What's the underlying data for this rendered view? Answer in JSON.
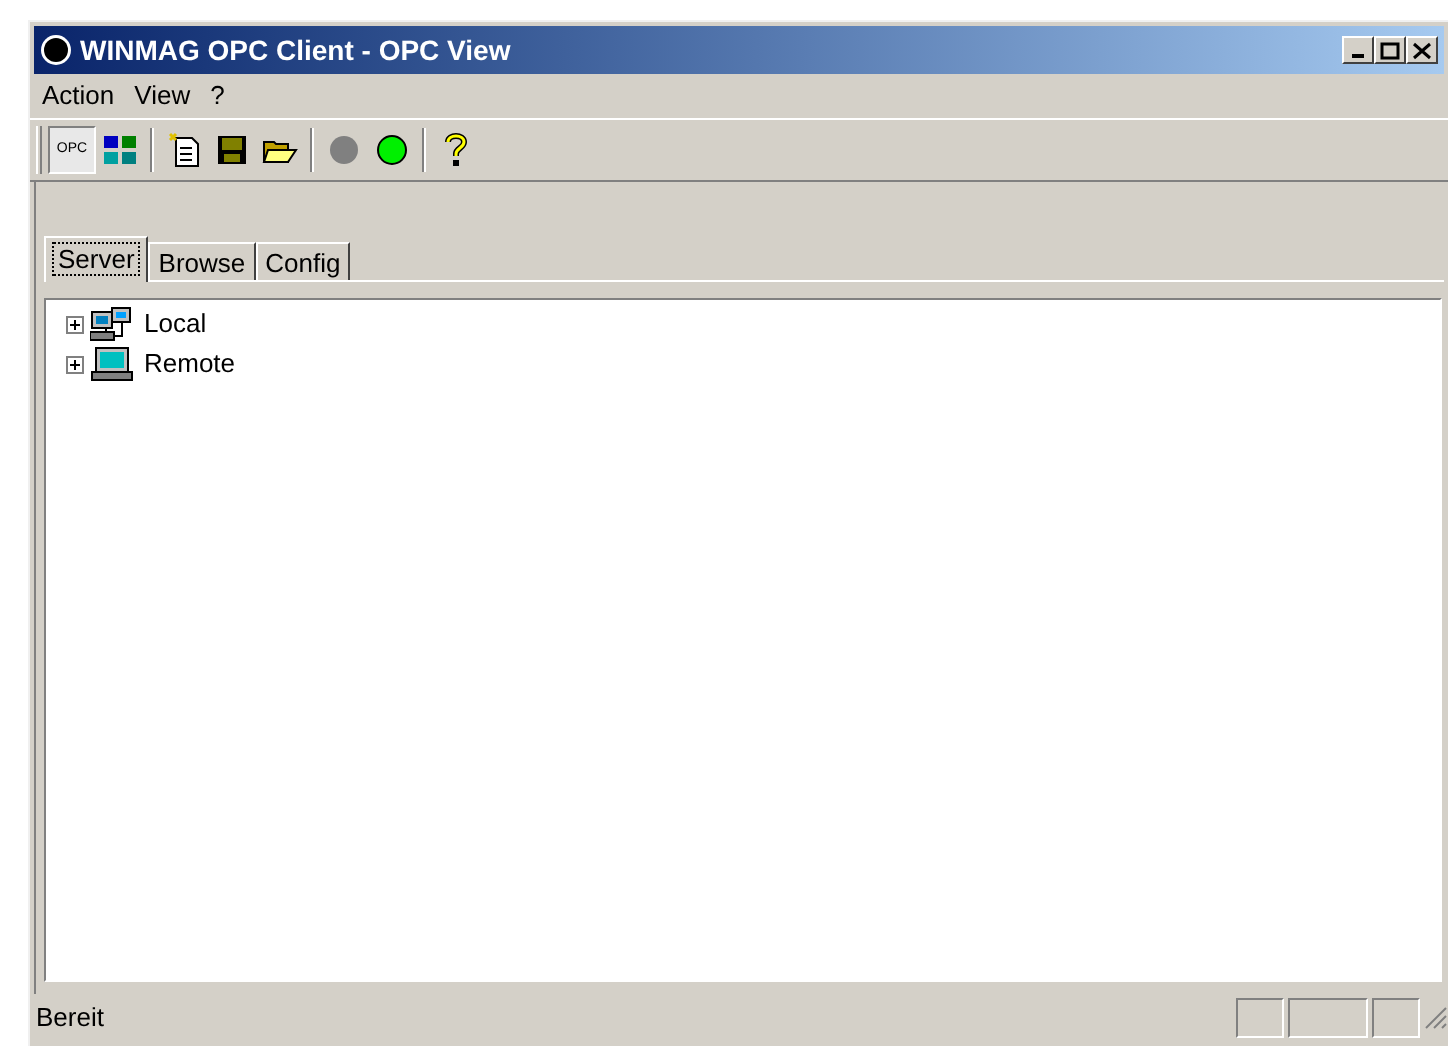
{
  "window": {
    "title": "WINMAG OPC Client - OPC View"
  },
  "menu": [
    "Action",
    "View",
    "?"
  ],
  "tabs": [
    {
      "label": "Server",
      "selected": true
    },
    {
      "label": "Browse",
      "selected": false
    },
    {
      "label": "Config",
      "selected": false
    }
  ],
  "toolbar": {
    "opc_label": "OPC"
  },
  "tree": [
    {
      "label": "Local",
      "expanded": false,
      "kind": "local"
    },
    {
      "label": "Remote",
      "expanded": false,
      "kind": "remote"
    }
  ],
  "status_bar": {
    "text": "Bereit"
  }
}
